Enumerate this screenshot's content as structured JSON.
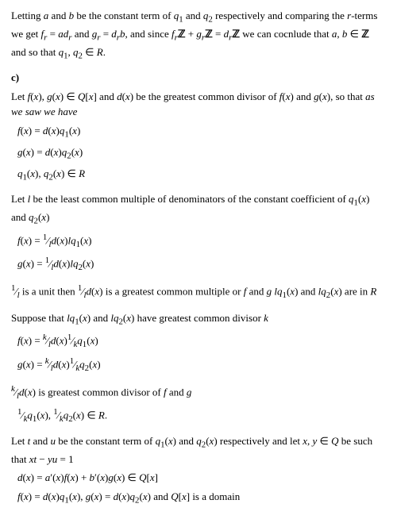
{
  "intro_text": "Letting a and b be the constant term of q₁ and q₂ respectively and comparing the r-terms we get f_r = ad_r and g_r = d_rb, and since f_rℤ + g_rℤ = d_rℤ we can cocnlude that a, b ∈ ℤ and so that q₁, q₂ ∈ R.",
  "section_c": "c)",
  "block1_intro": "Let f(x), g(x) ∈ Q[x] and d(x) be the greatest common divisor of f(x) and g(x), so that as we saw we have",
  "block1_lines": [
    "f(x) = d(x)q₁(x)",
    "g(x) = d(x)q₂(x)",
    "q₁(x), q₂(x) ∈ R"
  ],
  "block2_intro": "Let l be the least common multiple of denominators of the constant coefficient of q₁(x) and q₂(x)",
  "block2_lines": [
    "f(x) = (1/l)d(x)lq₁(x)",
    "g(x) = (1/l)d(x)lq₂(x)"
  ],
  "block3_text": "(1/l) is a unit then (1/l)d(x) is a greatest common multiple or f and g lq₁(x) and lq₂(x) are in R",
  "block4_intro": "Suppose that lq₁(x) and lq₂(x) have greatest common divisor k",
  "block4_lines": [
    "f(x) = (k/l)d(x)(1/k)q₁(x)",
    "g(x) = (k/l)d(x)(1/k)q₂(x)"
  ],
  "block5_text": "(k/l)d(x) is greatest common divisor of f and g",
  "block5_line2": "(1/k)q₁(x), (1/k)q₂(x) ∈ R.",
  "block6_intro": "Let t and u be the constant term of q₁(x) and q₂(x) respectively and let x, y ∈ Q be such that xt - yu = 1",
  "block6_lines": [
    "d(x) = a'(x)f(x) + b'(x)g(x) ∈ Q[x]",
    "f(x) = d(x)q₁(x), g(x) = d(x)q₂(x) and Q[x] is a domain"
  ]
}
